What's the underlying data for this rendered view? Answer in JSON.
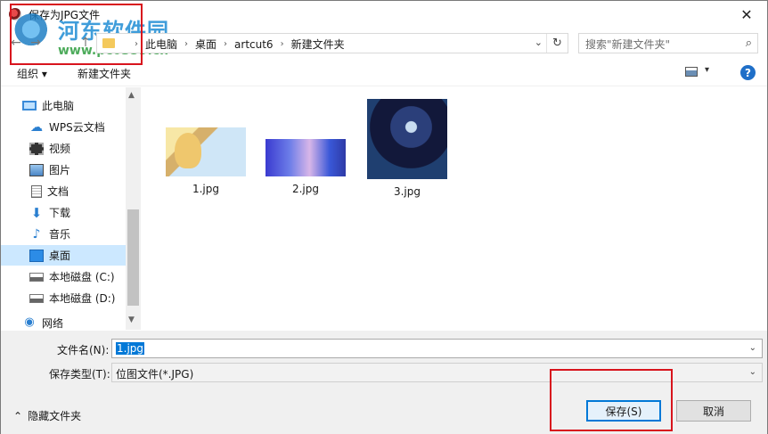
{
  "window": {
    "title": "保存为JPG文件",
    "close_glyph": "✕"
  },
  "watermark": {
    "text": "河东软件园",
    "url": "www.pc0359.cn"
  },
  "nav": {
    "back": "←",
    "forward": "→",
    "up": "↑",
    "breadcrumb": [
      "此电脑",
      "桌面",
      "artcut6",
      "新建文件夹"
    ],
    "separator": "›",
    "dropdown": "⌄",
    "refresh": "↻"
  },
  "search": {
    "placeholder": "搜索\"新建文件夹\"",
    "icon": "⌕"
  },
  "toolbar": {
    "organize": "组织 ▾",
    "new_folder": "新建文件夹",
    "view_dd": "▾",
    "help": "?"
  },
  "sidebar": {
    "items": [
      {
        "label": "此电脑",
        "icon": "pc-icon"
      },
      {
        "label": "WPS云文档",
        "icon": "cloud-icon"
      },
      {
        "label": "视频",
        "icon": "video-icon"
      },
      {
        "label": "图片",
        "icon": "picture-icon"
      },
      {
        "label": "文档",
        "icon": "document-icon"
      },
      {
        "label": "下载",
        "icon": "download-icon"
      },
      {
        "label": "音乐",
        "icon": "music-icon"
      },
      {
        "label": "桌面",
        "icon": "desktop-icon",
        "selected": true
      },
      {
        "label": "本地磁盘 (C:)",
        "icon": "drive-icon"
      },
      {
        "label": "本地磁盘 (D:)",
        "icon": "drive-icon"
      },
      {
        "label": "网络",
        "icon": "network-icon"
      }
    ],
    "scroll_up": "▲",
    "scroll_down": "▼"
  },
  "files": [
    {
      "name": "1.jpg"
    },
    {
      "name": "2.jpg"
    },
    {
      "name": "3.jpg"
    }
  ],
  "form": {
    "filename_label": "文件名(N):",
    "filename_value": "1.jpg",
    "filetype_label": "保存类型(T):",
    "filetype_value": "位图文件(*.JPG)",
    "dd": "⌄"
  },
  "footer": {
    "hide_folders": "隐藏文件夹",
    "hide_folders_icon": "⌃",
    "save": "保存(S)",
    "cancel": "取消"
  },
  "colors": {
    "highlight_box": "#d8141d",
    "selection": "#cce8ff",
    "accent": "#0078d7"
  }
}
